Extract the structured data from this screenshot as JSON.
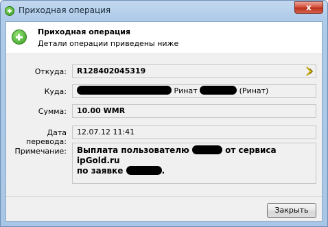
{
  "window": {
    "title": "Приходная операция",
    "close_glyph": "x"
  },
  "header": {
    "title": "Приходная операция",
    "subtitle": "Детали операции приведены ниже",
    "icon": "plus-circle-icon"
  },
  "fields": {
    "from": {
      "label": "Откуда:",
      "value": "R128402045319"
    },
    "to": {
      "label": "Куда:",
      "name": "Ринат",
      "suffix": "(Ринат)"
    },
    "amount": {
      "label": "Сумма:",
      "value": "10.00 WMR"
    },
    "date": {
      "label": "Дата перевода:",
      "value": "12.07.12 11:41"
    },
    "note": {
      "label": "Примечание:",
      "part1": "Выплата пользователю",
      "part2": "от сервиса ipGold.ru",
      "part3": "по заявке",
      "part4": "."
    }
  },
  "footer": {
    "close_label": "Закрыть"
  },
  "colors": {
    "accent_green": "#2f9a1a",
    "arrow_yellow": "#e0b800"
  }
}
